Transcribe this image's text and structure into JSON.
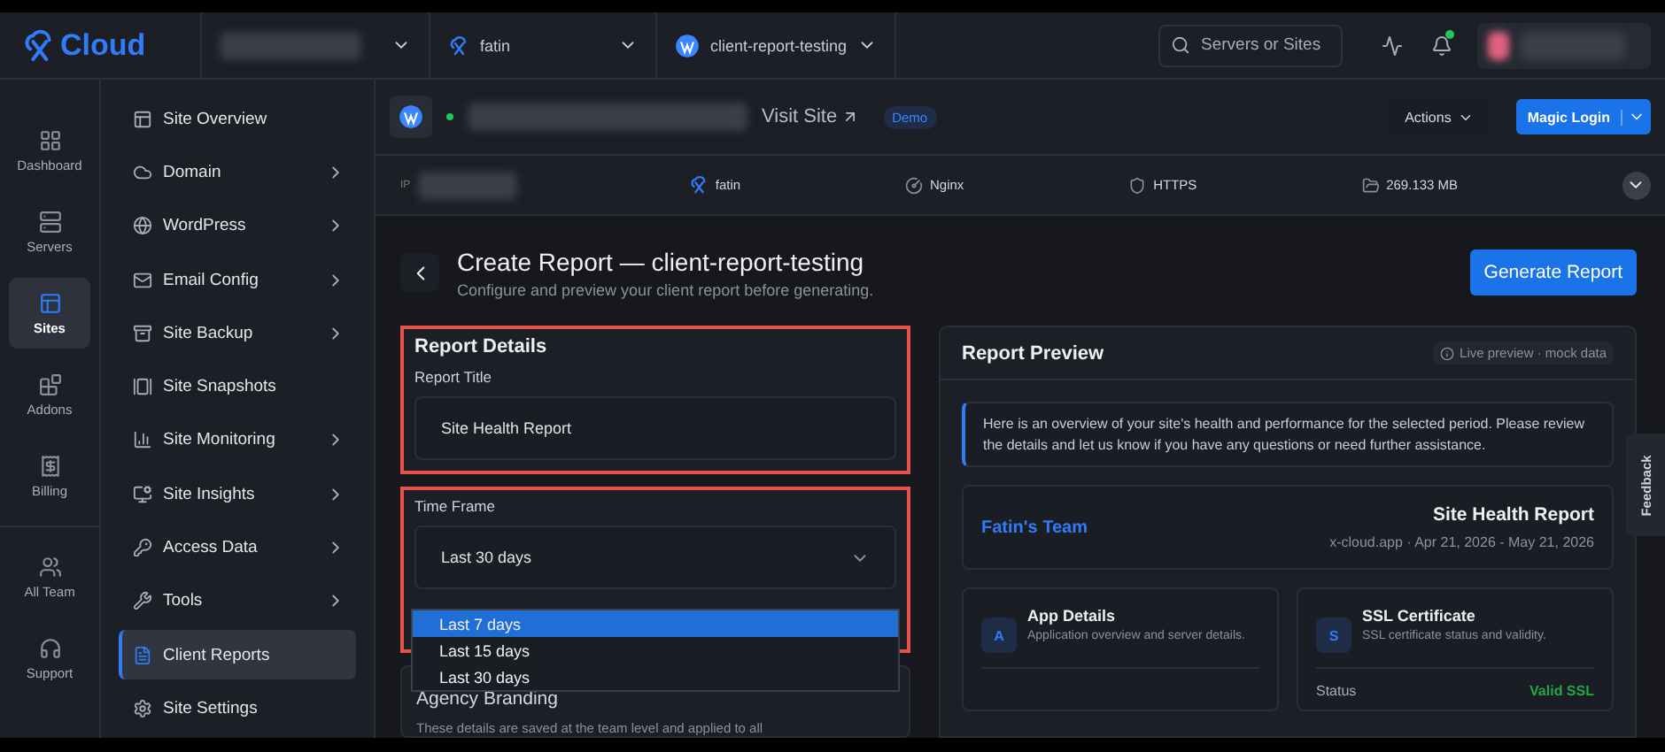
{
  "brand": {
    "logo_text": "Cloud"
  },
  "breadcrumbs": [
    {
      "kind": "org"
    },
    {
      "kind": "server",
      "label": "fatin"
    },
    {
      "kind": "site",
      "label": "client-report-testing"
    }
  ],
  "search": {
    "placeholder": "Servers or Sites"
  },
  "notifications": {
    "unread": true
  },
  "rail": [
    {
      "kind": "dashboard",
      "label": "Dashboard",
      "selected": false
    },
    {
      "kind": "servers",
      "label": "Servers",
      "selected": false
    },
    {
      "kind": "sites",
      "label": "Sites",
      "selected": true
    },
    {
      "kind": "addons",
      "label": "Addons",
      "selected": false
    },
    {
      "kind": "billing",
      "label": "Billing",
      "selected": false
    },
    {
      "kind": "team",
      "label": "All Team",
      "selected": false
    },
    {
      "kind": "support",
      "label": "Support",
      "selected": false
    }
  ],
  "nav": [
    {
      "kind": "overview",
      "label": "Site Overview",
      "expandable": false,
      "selected": false
    },
    {
      "kind": "domain",
      "label": "Domain",
      "expandable": true,
      "selected": false
    },
    {
      "kind": "wordpress",
      "label": "WordPress",
      "expandable": true,
      "selected": false
    },
    {
      "kind": "email",
      "label": "Email Config",
      "expandable": true,
      "selected": false
    },
    {
      "kind": "backup",
      "label": "Site Backup",
      "expandable": true,
      "selected": false
    },
    {
      "kind": "snapshots",
      "label": "Site Snapshots",
      "expandable": false,
      "selected": false
    },
    {
      "kind": "monitoring",
      "label": "Site Monitoring",
      "expandable": true,
      "selected": false
    },
    {
      "kind": "insights",
      "label": "Site Insights",
      "expandable": true,
      "selected": false
    },
    {
      "kind": "access",
      "label": "Access Data",
      "expandable": true,
      "selected": false
    },
    {
      "kind": "tools",
      "label": "Tools",
      "expandable": true,
      "selected": false
    },
    {
      "kind": "reports",
      "label": "Client Reports",
      "expandable": false,
      "selected": true
    },
    {
      "kind": "settings",
      "label": "Site Settings",
      "expandable": false,
      "selected": false
    }
  ],
  "site_header": {
    "online": true,
    "visit_label": "Visit Site",
    "badge": "Demo",
    "actions": "Actions",
    "magic_login": "Magic Login"
  },
  "info_bar": [
    {
      "kind": "ip",
      "label": "IP"
    },
    {
      "kind": "server",
      "label": "fatin"
    },
    {
      "kind": "stack",
      "label": "Nginx"
    },
    {
      "kind": "https",
      "label": "HTTPS"
    },
    {
      "kind": "disk",
      "label": "269.133 MB"
    }
  ],
  "page": {
    "title": "Create Report — client-report-testing",
    "subtitle": "Configure and preview your client report before generating.",
    "generate": "Generate Report"
  },
  "form": {
    "section_title": "Report Details",
    "title_label": "Report Title",
    "title_value": "Site Health Report",
    "timeframe_label": "Time Frame",
    "timeframe_value": "Last 30 days",
    "dropdown_open": true,
    "options": [
      {
        "label": "Last 7 days",
        "selected": true
      },
      {
        "label": "Last 15 days",
        "selected": false
      },
      {
        "label": "Last 30 days",
        "selected": false
      }
    ],
    "branding_title": "Agency Branding",
    "branding_note": "These details are saved at the team level and applied to all"
  },
  "preview": {
    "title": "Report Preview",
    "hint": "Live preview · mock data",
    "intro": "Here is an overview of your site's health and performance for the selected period. Please review the details and let us know if you have any questions or need further assistance.",
    "team": "Fatin's Team",
    "report_title": "Site Health Report",
    "meta": "x-cloud.app · Apr 21, 2026 - May 21, 2026",
    "cards": [
      {
        "letter": "A",
        "title": "App Details",
        "desc": "Application overview and server details."
      },
      {
        "letter": "S",
        "title": "SSL Certificate",
        "desc": "SSL certificate status and validity.",
        "rows": [
          {
            "label": "Status",
            "value": "Valid SSL"
          }
        ]
      }
    ]
  },
  "feedback": "Feedback"
}
